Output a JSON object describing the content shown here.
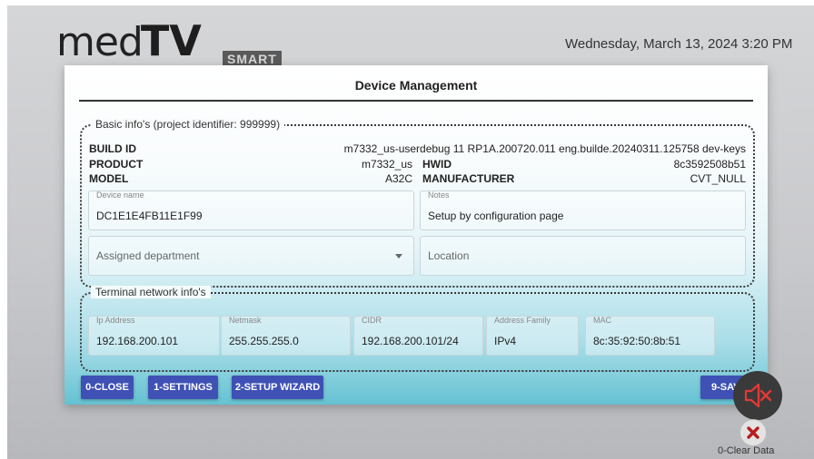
{
  "header": {
    "logo": {
      "med": "med",
      "tv": "TV",
      "smart": "SMART"
    },
    "datetime": "Wednesday, March 13, 2024 3:20 PM"
  },
  "dialog": {
    "title": "Device Management",
    "basic": {
      "legend": "Basic info's (project identifier: 999999)",
      "build_id_label": "BUILD ID",
      "build_id_value": "m7332_us-userdebug 11 RP1A.200720.011 eng.builde.20240311.125758 dev-keys",
      "product_label": "PRODUCT",
      "product_value": "m7332_us",
      "hwid_label": "HWID",
      "hwid_value": "8c3592508b51",
      "model_label": "MODEL",
      "model_value": "A32C",
      "manufacturer_label": "MANUFACTURER",
      "manufacturer_value": "CVT_NULL",
      "device_name_label": "Device name",
      "device_name_value": "DC1E1E4FB11E1F99",
      "notes_label": "Notes",
      "notes_value": "Setup by configuration page",
      "department_placeholder": "Assigned department",
      "location_placeholder": "Location"
    },
    "network": {
      "legend": "Terminal network info's",
      "fields": [
        {
          "label": "Ip Address",
          "value": "192.168.200.101"
        },
        {
          "label": "Netmask",
          "value": "255.255.255.0"
        },
        {
          "label": "CIDR",
          "value": "192.168.200.101/24"
        },
        {
          "label": "Address Family",
          "value": "IPv4"
        },
        {
          "label": "MAC",
          "value": "8c:35:92:50:8b:51"
        }
      ]
    },
    "buttons": {
      "close": "0-CLOSE",
      "settings": "1-SETTINGS",
      "wizard": "2-SETUP WIZARD",
      "save": "9-SAVE"
    }
  },
  "overlay": {
    "clear_data": "0-Clear Data",
    "mute_icon": "speaker-muted-icon",
    "clear_icon": "close-icon",
    "mute_accent": "#e53935"
  }
}
